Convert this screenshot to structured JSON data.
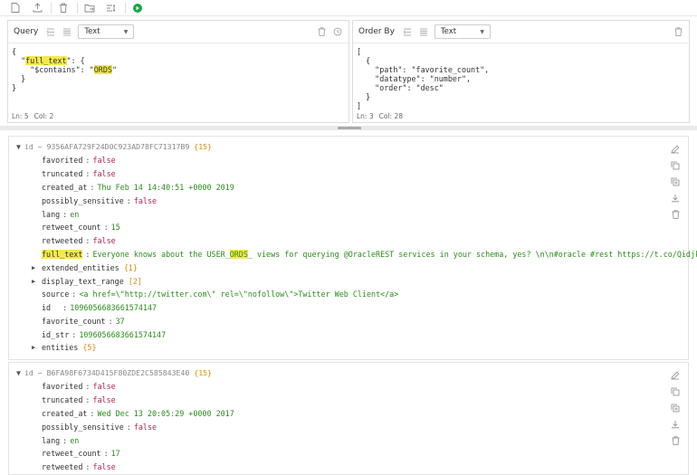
{
  "query_panel": {
    "label": "Query",
    "format": "Text",
    "lines": [
      "{",
      "  \"full_text\": {",
      "    \"$contains\": \"ORDS\"",
      "  }",
      "}"
    ],
    "status_ln": "Ln: 5",
    "status_col": "Col: 2"
  },
  "order_panel": {
    "label": "Order By",
    "format": "Text",
    "lines": [
      "[",
      "  {",
      "    \"path\": \"favorite_count\",",
      "    \"datatype\": \"number\",",
      "    \"order\": \"desc\"",
      "  }",
      "]"
    ],
    "status_ln": "Ln: 3",
    "status_col": "Col: 28"
  },
  "docs": [
    {
      "id_label": "id ~ 9356AFA729F24D0C923AD78FC71317B9",
      "count": "{15}",
      "fields": [
        {
          "k": "favorited",
          "v": "false"
        },
        {
          "k": "truncated",
          "v": "false"
        },
        {
          "k": "created_at",
          "v": "Thu Feb 14 14:40:51 +0000 2019"
        },
        {
          "k": "possibly_sensitive",
          "v": "false"
        },
        {
          "k": "lang",
          "v": "en"
        },
        {
          "k": "retweet_count",
          "v": "15"
        },
        {
          "k": "retweeted",
          "v": "false"
        },
        {
          "k": "full_text",
          "v_pre": "Everyone knows about the USER_",
          "v_hl": "ORDS",
          "v_post": "_ views for querying @OracleREST services in your schema, yes? \\n\\n#oracle #rest https://t.co/QidjkCChZZ"
        },
        {
          "k": "extended_entities",
          "v": "{1}"
        },
        {
          "k": "display_text_range",
          "v": "[2]"
        },
        {
          "k": "source",
          "v": "<a href=\\\"http://twitter.com\\\" rel=\\\"nofollow\\\">Twitter Web Client</a>"
        },
        {
          "k": "id",
          "v": "1096056683661574147"
        },
        {
          "k": "favorite_count",
          "v": "37"
        },
        {
          "k": "id_str",
          "v": "1096056683661574147"
        },
        {
          "k": "entities",
          "v": "{5}"
        }
      ]
    },
    {
      "id_label": "id ~ B6FA98F6734D415F80ZDE2C585843E40",
      "count": "{15}",
      "fields": [
        {
          "k": "favorited",
          "v": "false"
        },
        {
          "k": "truncated",
          "v": "false"
        },
        {
          "k": "created_at",
          "v": "Wed Dec 13 20:05:29 +0000 2017"
        },
        {
          "k": "possibly_sensitive",
          "v": "false"
        },
        {
          "k": "lang",
          "v": "en"
        },
        {
          "k": "retweet_count",
          "v": "17"
        },
        {
          "k": "retweeted",
          "v": "false"
        }
      ]
    }
  ]
}
